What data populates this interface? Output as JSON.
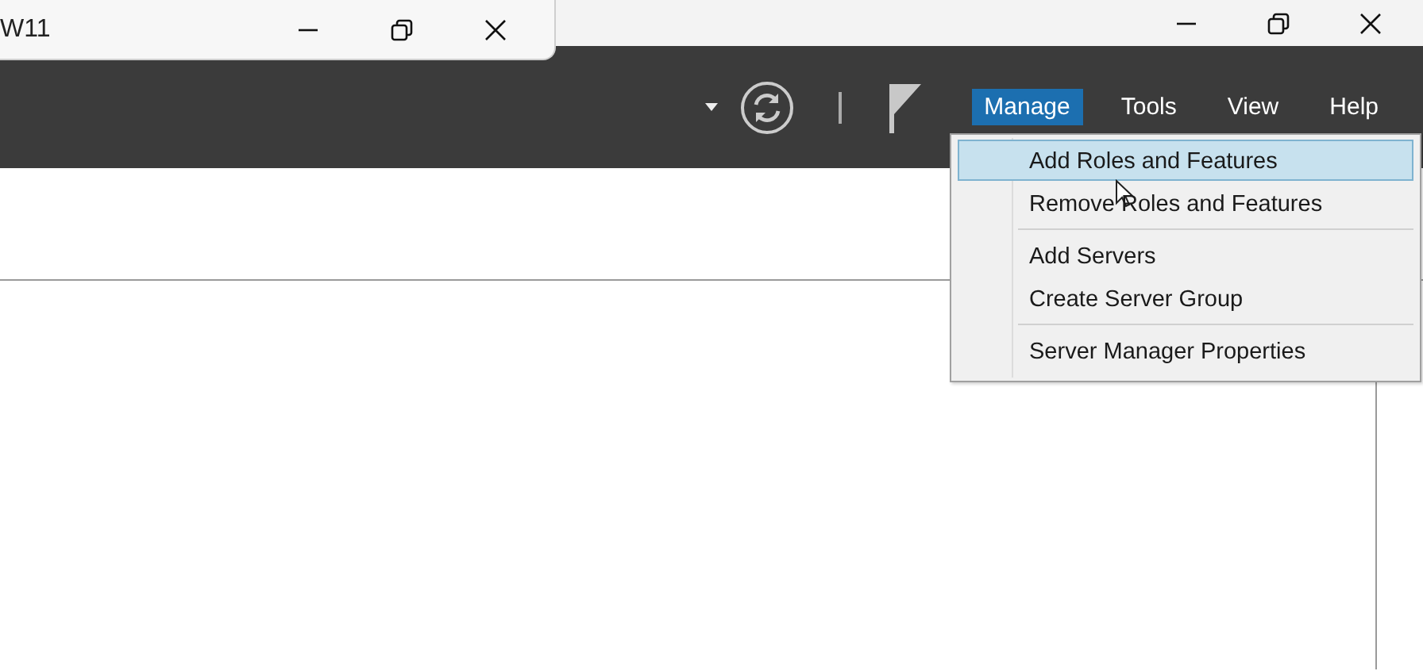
{
  "window": {
    "title": "W11"
  },
  "menu_bar": [
    {
      "label": "Manage",
      "selected": true
    },
    {
      "label": "Tools",
      "selected": false
    },
    {
      "label": "View",
      "selected": false
    },
    {
      "label": "Help",
      "selected": false
    }
  ],
  "dropdown": {
    "items": [
      {
        "kind": "item",
        "label": "Add Roles and Features",
        "selected": true
      },
      {
        "kind": "item",
        "label": "Remove Roles and Features",
        "selected": false
      },
      {
        "kind": "separator"
      },
      {
        "kind": "item",
        "label": "Add Servers",
        "selected": false
      },
      {
        "kind": "item",
        "label": "Create Server Group",
        "selected": false
      },
      {
        "kind": "separator"
      },
      {
        "kind": "item",
        "label": "Server Manager Properties",
        "selected": false
      }
    ]
  }
}
